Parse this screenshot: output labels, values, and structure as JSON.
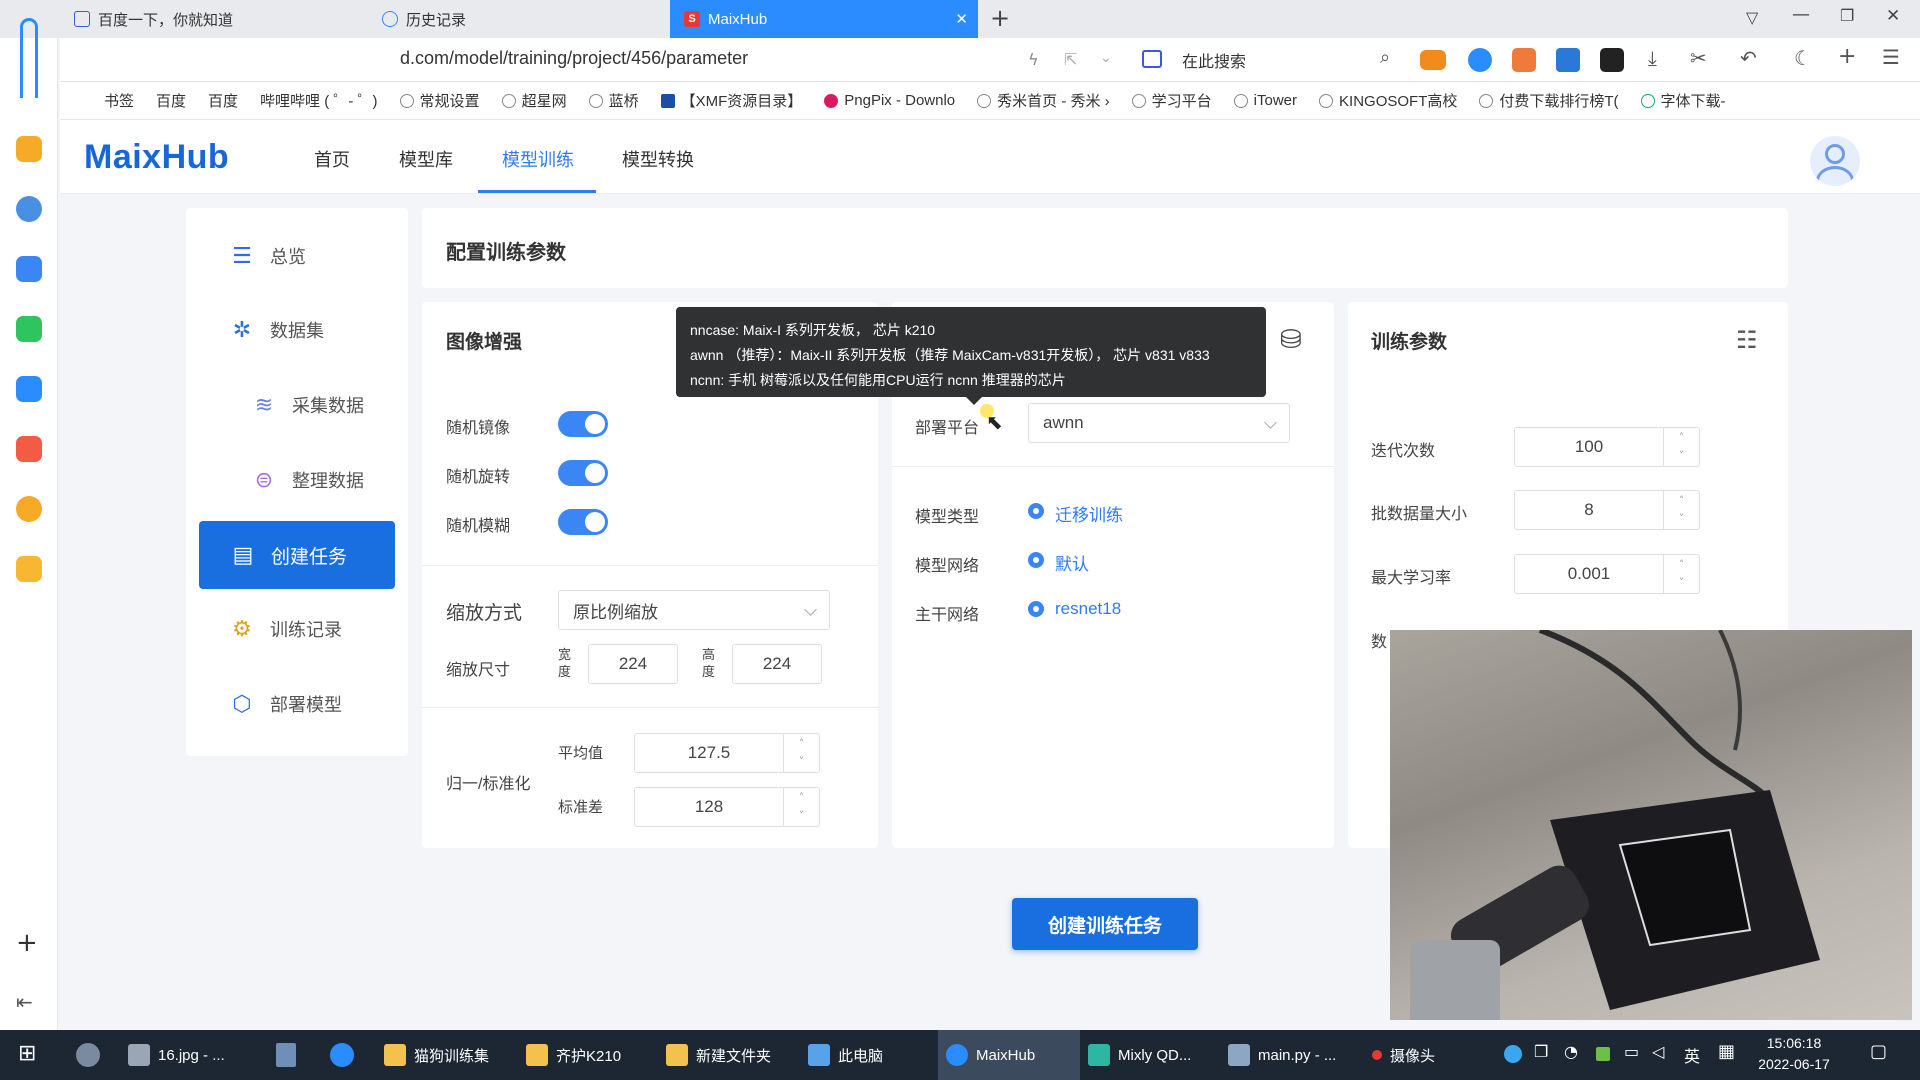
{
  "browser": {
    "tabs": [
      {
        "label": "百度一下，你就知道"
      },
      {
        "label": "历史记录"
      },
      {
        "label": "MaixHub",
        "active": true
      }
    ],
    "new_tab_icon": "plus-icon",
    "url": "d.com/model/training/project/456/parameter",
    "search_placeholder": "在此搜索",
    "bookmarks": [
      "常规设置",
      "超星网",
      "蓝桥",
      "【XMF资源目录】",
      "PngPix - Downlo",
      "秀米首页 - 秀米 ›",
      "学习平台",
      "iTower",
      "KINGOSOFT高校",
      "付费下载排行榜T(",
      "字体下载-"
    ],
    "bookmark_partial": [
      "书签",
      "百度",
      "百度",
      "哔哩哔哩 ( ゜- ゜)"
    ]
  },
  "app": {
    "logo": "MaixHub",
    "nav": [
      "首页",
      "模型库",
      "模型训练",
      "模型转换"
    ],
    "active_nav": "模型训练",
    "accent_color": "#2f7bf5"
  },
  "sidebar": {
    "items": [
      {
        "label": "总览",
        "icon": "list-icon"
      },
      {
        "label": "数据集",
        "icon": "dataset-icon"
      },
      {
        "label": "采集数据",
        "icon": "database-icon"
      },
      {
        "label": "整理数据",
        "icon": "organize-icon"
      },
      {
        "label": "创建任务",
        "icon": "create-task-icon",
        "active": true
      },
      {
        "label": "训练记录",
        "icon": "record-icon"
      },
      {
        "label": "部署模型",
        "icon": "box-icon"
      }
    ]
  },
  "page": {
    "title": "配置训练参数"
  },
  "augment": {
    "title": "图像增强",
    "toggles": [
      {
        "label": "随机镜像",
        "on": true
      },
      {
        "label": "随机旋转",
        "on": true
      },
      {
        "label": "随机模糊",
        "on": true
      }
    ],
    "scale_mode_label": "缩放方式",
    "scale_mode_value": "原比例缩放",
    "scale_size_label": "缩放尺寸",
    "width_label": "宽度",
    "width_value": "224",
    "height_label": "高度",
    "height_value": "224",
    "normalize_label": "归一/标准化",
    "mean_label": "平均值",
    "mean_value": "127.5",
    "std_label": "标准差",
    "std_value": "128"
  },
  "platform": {
    "deploy_label": "部署平台",
    "deploy_value": "awnn",
    "model_type_label": "模型类型",
    "model_type_value": "迁移训练",
    "network_label": "模型网络",
    "network_value": "默认",
    "backbone_label": "主干网络",
    "backbone_value": "resnet18"
  },
  "tooltip": {
    "line1": "nncase: Maix-I 系列开发板， 芯片 k210",
    "line2": "awnn （推荐）：Maix-II 系列开发板（推荐 MaixCam-v831开发板），  芯片 v831 v833",
    "line3": "ncnn: 手机 树莓派以及任何能用CPU运行 ncnn 推理器的芯片"
  },
  "training": {
    "title": "训练参数",
    "epochs_label": "迭代次数",
    "epochs_value": "100",
    "batch_label": "批数据量大小",
    "batch_value": "8",
    "lr_label": "最大学习率",
    "lr_value": "0.001",
    "partial_label": "数"
  },
  "create_button": "创建训练任务",
  "taskbar": {
    "items": [
      "16.jpg - ...",
      "猫狗训练集",
      "齐护K210",
      "新建文件夹",
      "此电脑",
      "MaixHub",
      "Mixly QD...",
      "main.py - ...",
      "摄像头"
    ],
    "ime": "英",
    "time": "15:06:18",
    "date": "2022-06-17"
  }
}
